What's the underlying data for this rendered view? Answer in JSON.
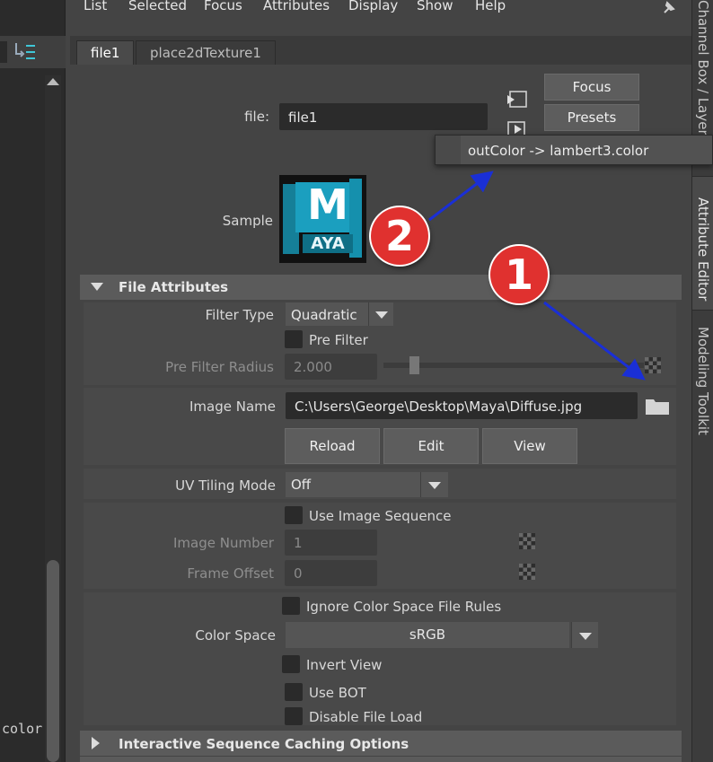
{
  "menu": [
    "List",
    "Selected",
    "Focus",
    "Attributes",
    "Display",
    "Show",
    "Help"
  ],
  "tabs": [
    "file1",
    "place2dTexture1"
  ],
  "node": {
    "label": "file:",
    "value": "file1"
  },
  "buttons": {
    "focus": "Focus",
    "presets": "Presets"
  },
  "popup": {
    "text": "outColor -> lambert3.color"
  },
  "sample": {
    "label": "Sample",
    "logo_letter": "M",
    "logo_text": "AYA"
  },
  "badges": [
    "1",
    "2"
  ],
  "sections": {
    "file_attributes": "File Attributes",
    "interactive_caching": "Interactive Sequence Caching Options"
  },
  "filter": {
    "type_label": "Filter Type",
    "type_value": "Quadratic",
    "pre_filter_label": "Pre Filter",
    "radius_label": "Pre Filter Radius",
    "radius_value": "2.000"
  },
  "image": {
    "label": "Image Name",
    "value": "C:\\Users\\George\\Desktop\\Maya\\Diffuse.jpg",
    "reload": "Reload",
    "edit": "Edit",
    "view": "View"
  },
  "uv": {
    "label": "UV Tiling Mode",
    "value": "Off"
  },
  "sequence": {
    "use_label": "Use Image Sequence",
    "image_number_label": "Image Number",
    "image_number_value": "1",
    "frame_offset_label": "Frame Offset",
    "frame_offset_value": "0"
  },
  "color": {
    "ignore_label": "Ignore Color Space File Rules",
    "space_label": "Color Space",
    "space_value": "sRGB",
    "invert_label": "Invert View",
    "bot_label": "Use BOT",
    "disable_label": "Disable File Load"
  },
  "side_tabs": [
    "Channel Box / Layer E",
    "Attribute Editor",
    "Modeling Toolkit"
  ],
  "left": {
    "cut_text": "color"
  },
  "colors": {
    "annotation_arrow": "#1a2fd6",
    "badge": "#e0312f",
    "logo": "#1b9fbf"
  }
}
